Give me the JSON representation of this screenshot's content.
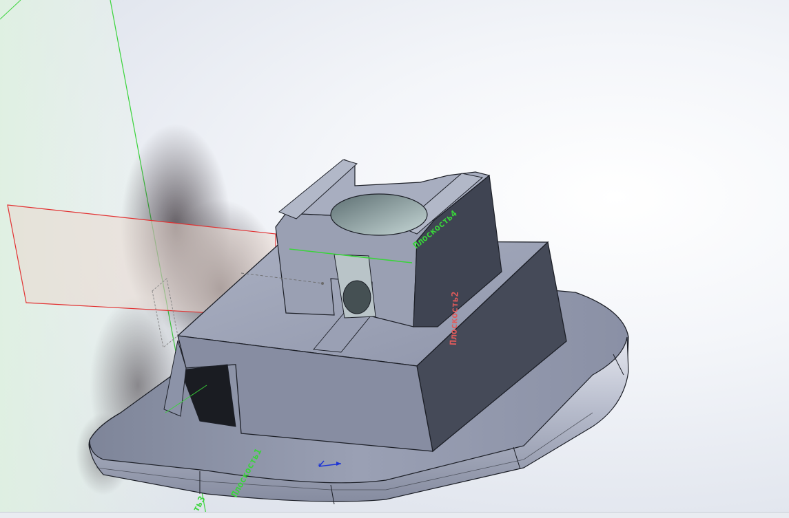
{
  "app": {
    "view": "3D model viewport"
  },
  "planes": {
    "plane1": {
      "label": "Плоскость1",
      "color": "#39d43a"
    },
    "plane2": {
      "label": "Плоскость2",
      "color": "#e15b5b"
    },
    "plane4": {
      "label": "Плоскость4",
      "color": "#39d43a"
    },
    "plane_fragment": {
      "label": "ть3",
      "color": "#39d43a"
    }
  },
  "colors": {
    "part_top": "#9da4b8",
    "part_side_dark": "#454a58",
    "part_front": "#878da2",
    "edge": "#1c1f27",
    "triad_axis": "#1d34d6"
  }
}
